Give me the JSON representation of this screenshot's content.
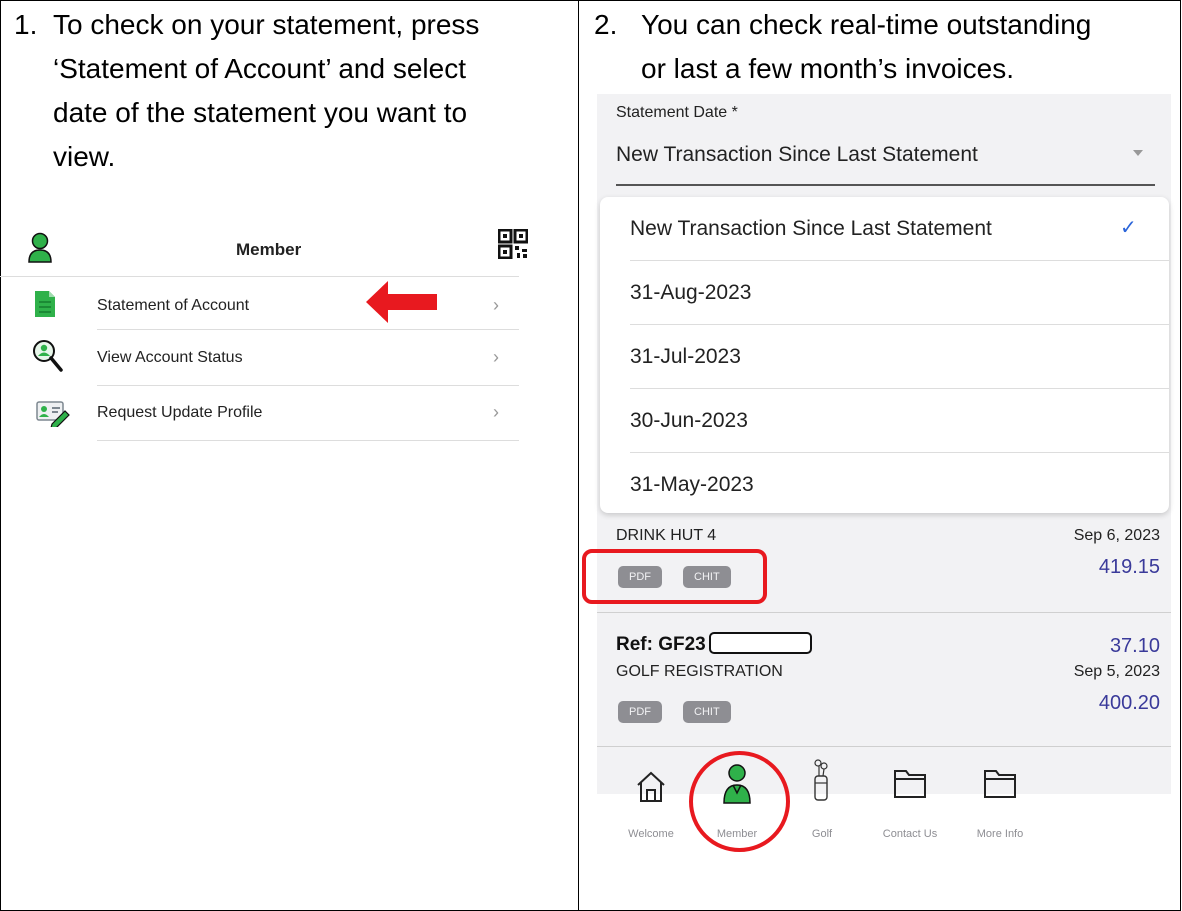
{
  "steps": [
    {
      "number": "1.",
      "lines": [
        "To check on your statement, press",
        "‘Statement of Account’ and select",
        "date of the statement you want to",
        "view."
      ]
    },
    {
      "number": "2.",
      "lines": [
        "You can check real-time outstanding",
        "or last a few month’s invoices."
      ]
    }
  ],
  "member_screen": {
    "title": "Member",
    "menu_items": [
      {
        "label": "Statement of Account",
        "icon": "document-icon"
      },
      {
        "label": "View Account Status",
        "icon": "magnifier-user-icon"
      },
      {
        "label": "Request Update Profile",
        "icon": "id-card-edit-icon"
      }
    ],
    "colors": {
      "icon_green": "#2fb14a",
      "arrow_red": "#e8191f"
    }
  },
  "statement_screen": {
    "field_label": "Statement Date *",
    "field_value": "New Transaction Since Last Statement",
    "options": [
      {
        "label": "New Transaction Since Last Statement",
        "selected": true
      },
      {
        "label": "31-Aug-2023",
        "selected": false
      },
      {
        "label": "31-Jul-2023",
        "selected": false
      },
      {
        "label": "30-Jun-2023",
        "selected": false
      },
      {
        "label": "31-May-2023",
        "selected": false
      }
    ],
    "transactions": [
      {
        "description": "DRINK HUT 4",
        "date": "Sep 6, 2023",
        "amount": "419.15",
        "buttons": [
          "PDF",
          "CHIT"
        ]
      },
      {
        "ref": "Ref: GF23",
        "ref_amount": "37.10",
        "description": "GOLF REGISTRATION",
        "date": "Sep 5, 2023",
        "amount": "400.20",
        "buttons": [
          "PDF",
          "CHIT"
        ]
      }
    ],
    "tabs": [
      {
        "label": "Welcome",
        "icon": "home-icon"
      },
      {
        "label": "Member",
        "icon": "member-icon"
      },
      {
        "label": "Golf",
        "icon": "golf-bag-icon"
      },
      {
        "label": "Contact Us",
        "icon": "folder-icon"
      },
      {
        "label": "More Info",
        "icon": "folder-icon"
      }
    ],
    "colors": {
      "amount_blue": "#3a3a9a",
      "check_blue": "#2a64d9",
      "highlight_red": "#e8191f"
    }
  }
}
